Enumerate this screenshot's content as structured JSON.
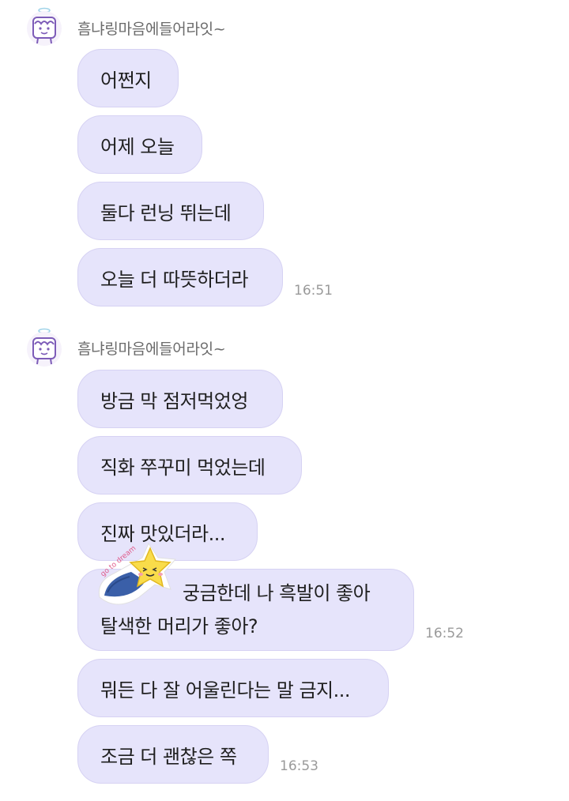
{
  "groups": [
    {
      "sender": "흠냐링마음에들어라잇~",
      "messages": [
        {
          "text": "어쩐지"
        },
        {
          "text": "어제 오늘"
        },
        {
          "text": "둘다 런닝 뛰는데"
        },
        {
          "text": "오늘 더 따뜻하더라",
          "time": "16:51"
        }
      ]
    },
    {
      "sender": "흠냐링마음에들어라잇~",
      "messages": [
        {
          "text": "방금 막 점저먹었엉"
        },
        {
          "text": "직화 쭈꾸미 먹었는데"
        },
        {
          "text": "진짜 맛있더라..."
        },
        {
          "line1": "궁금한데 나 흑발이 좋아",
          "line2": "탈색한 머리가 좋아?",
          "time": "16:52",
          "sticker": {
            "text": "go to dream",
            "icon": "star-sticker-icon"
          }
        },
        {
          "text": "뭐든 다 잘 어울린다는 말 금지..."
        },
        {
          "text": "조금 더 괜찮은 쪽",
          "time": "16:53"
        }
      ]
    }
  ],
  "colors": {
    "bubble": "#e6e4fb",
    "bubble_border": "#d6d2f3",
    "text": "#1f1f1f",
    "time": "#9a9a9a",
    "sender": "#6b6b6b",
    "avatar_accent": "#8c6fc4"
  }
}
